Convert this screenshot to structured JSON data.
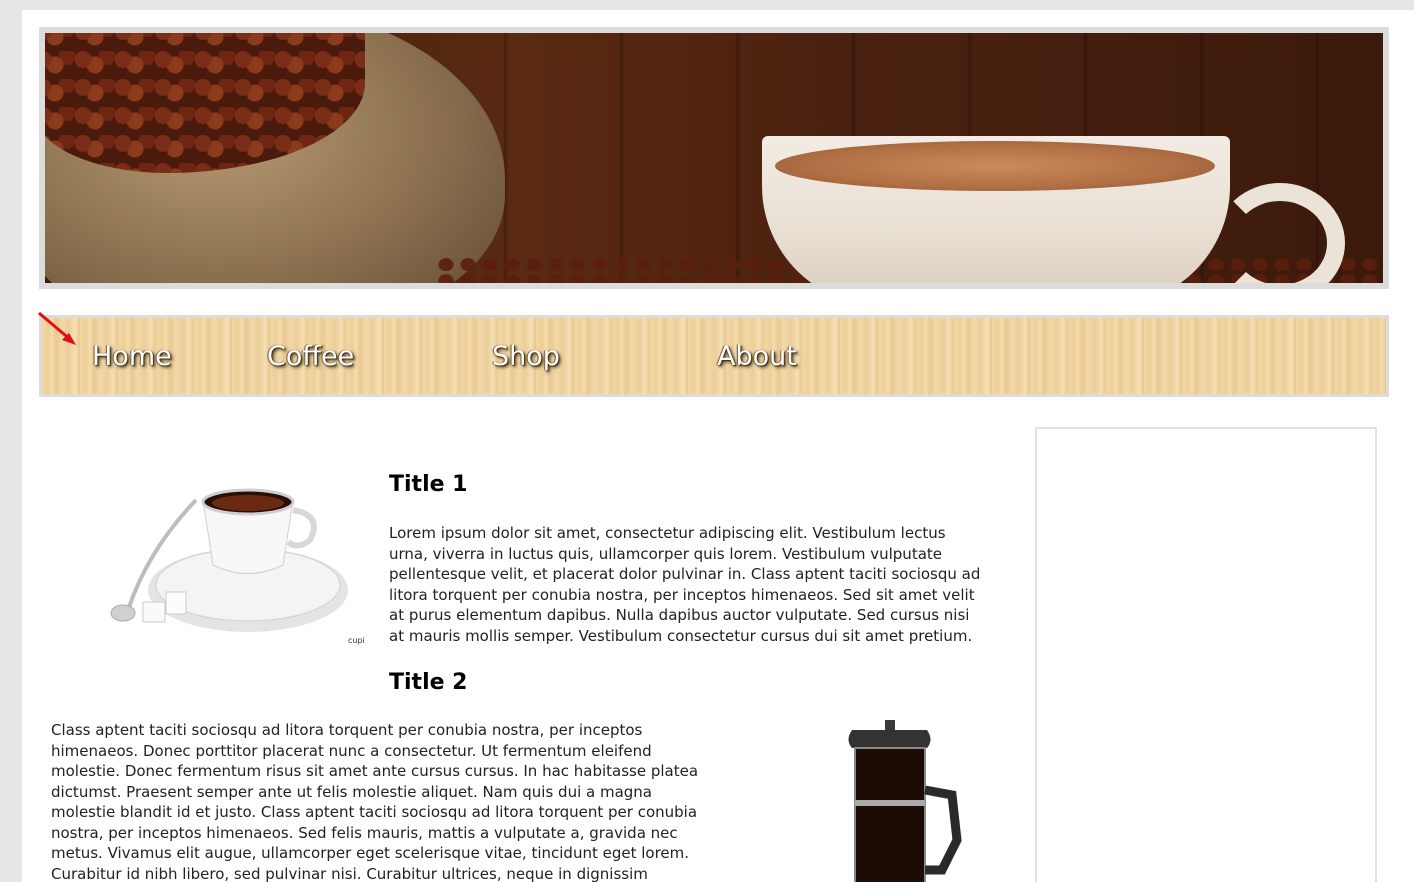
{
  "banner": {
    "alt": "Coffee beans in burlap sack and cup of coffee"
  },
  "nav": {
    "items": [
      {
        "label": "Home"
      },
      {
        "label": "Coffee"
      },
      {
        "label": "Shop"
      },
      {
        "label": "About"
      }
    ]
  },
  "main": {
    "section1": {
      "title": "Title 1",
      "text": "Lorem ipsum dolor sit amet, consectetur adipiscing elit. Vestibulum lectus urna, viverra in luctus quis, ullamcorper quis lorem. Vestibulum vulputate pellentesque velit, et placerat dolor pulvinar in. Class aptent taciti sociosqu ad litora torquent per conubia nostra, per inceptos himenaeos. Sed sit amet velit at purus elementum dapibus. Nulla dapibus auctor vulputate. Sed cursus nisi at mauris mollis semper. Vestibulum consectetur cursus dui sit amet pretium."
    },
    "section2": {
      "title": "Title 2",
      "text": "Class aptent taciti sociosqu ad litora torquent per conubia nostra, per inceptos himenaeos. Donec porttitor placerat nunc a consectetur. Ut fermentum eleifend molestie. Donec fermentum risus sit amet ante cursus cursus. In hac habitasse platea dictumst. Praesent semper ante ut felis molestie aliquet. Nam quis dui a magna molestie blandit id et justo. Class aptent taciti sociosqu ad litora torquent per conubia nostra, per inceptos himenaeos. Sed felis mauris, mattis a vulputate a, gravida nec metus. Vivamus elit augue, ullamcorper eget scelerisque vitae, tincidunt eget lorem. Curabitur id nibh libero, sed pulvinar nisi. Curabitur ultrices, neque in dignissim viverra, justo nisl dignissim magna, a tempor eros turpis in diam. Suspendisse potenti. Sed tincidunt est ac elit bibendum nec varius ante."
    },
    "image1_caption": "cupic"
  },
  "colors": {
    "page_bg": "#e6e6e6",
    "nav_wood": "#f1d7a5",
    "annotation_arrow": "#e01010"
  }
}
